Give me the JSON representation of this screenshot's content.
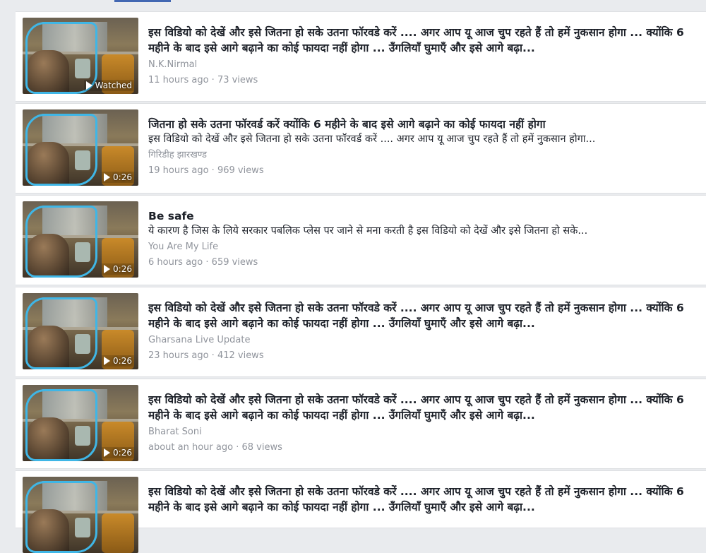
{
  "colors": {
    "accent": "#4267b2",
    "background": "#e9ebee",
    "meta_text": "#90949c",
    "thumb_outline": "#3fb6e6"
  },
  "videos": [
    {
      "title": "इस विडियो को देखें और इसे जितना हो सके उतना फॉरवडे करें .... अगर आप यू आज चुप रहते हैं तो हमें नुकसान होगा ... क्योंकि 6 महीने के बाद इसे आगे बढ़ाने का कोई फायदा नहीं होगा ... उँगलियाँ घुमाएँ और इसे आगे बढ़ा...",
      "description": "",
      "author": "N.K.Nirmal",
      "time": "11 hours ago",
      "views": "73 views",
      "badge": "Watched"
    },
    {
      "title": "जितना हो सके उतना फॉरवर्ड करें क्योंकि 6 महीने के बाद इसे आगे बढ़ाने का कोई फायदा नहीं होगा",
      "description": "इस विडियो को देखें और इसे जितना हो सके उतना फॉरवर्ड करें .... अगर आप यू आज चुप रहते हैं तो हमें नुकसान होगा...",
      "author": "गिरिडीह झारखण्ड",
      "time": "19 hours ago",
      "views": "969 views",
      "badge": "0:26"
    },
    {
      "title": "Be safe",
      "description": "ये कारण है जिस के लिये सरकार पबलिक प्लेस पर जाने से मना करती है इस विडियो को देखें और इसे जितना हो सके...",
      "author": "You Are My Life",
      "time": "6 hours ago",
      "views": "659 views",
      "badge": "0:26"
    },
    {
      "title": "इस विडियो को देखें और इसे जितना हो सके उतना फॉरवडे करें .... अगर आप यू आज चुप रहते हैं तो हमें नुकसान होगा ... क्योंकि 6 महीने के बाद इसे आगे बढ़ाने का कोई फायदा नहीं होगा ... उँगलियाँ घुमाएँ और इसे आगे बढ़ा...",
      "description": "",
      "author": "Gharsana Live Update",
      "time": "23 hours ago",
      "views": "412 views",
      "badge": "0:26"
    },
    {
      "title": "इस विडियो को देखें और इसे जितना हो सके उतना फॉरवडे करें .... अगर आप यू आज चुप रहते हैं तो हमें नुकसान होगा ... क्योंकि 6 महीने के बाद इसे आगे बढ़ाने का कोई फायदा नहीं होगा ... उँगलियाँ घुमाएँ और इसे आगे बढ़ा...",
      "description": "",
      "author": "Bharat Soni",
      "time": "about an hour ago",
      "views": "68 views",
      "badge": "0:26"
    },
    {
      "title": "इस विडियो को देखें और इसे जितना हो सके उतना फॉरवडे करें .... अगर आप यू आज चुप रहते हैं तो हमें नुकसान होगा ... क्योंकि 6 महीने के बाद इसे आगे बढ़ाने का कोई फायदा नहीं होगा ... उँगलियाँ घुमाएँ और इसे आगे बढ़ा...",
      "description": "",
      "author": "",
      "time": "",
      "views": "",
      "badge": ""
    }
  ]
}
